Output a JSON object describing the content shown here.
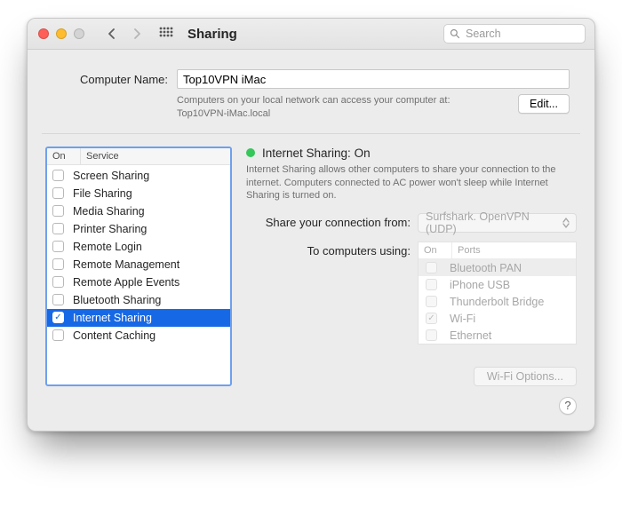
{
  "toolbar": {
    "title": "Sharing",
    "search_placeholder": "Search"
  },
  "computer_name": {
    "label": "Computer Name:",
    "value": "Top10VPN iMac",
    "hint_line1": "Computers on your local network can access your computer at:",
    "hint_line2": "Top10VPN-iMac.local",
    "edit_label": "Edit..."
  },
  "services": {
    "headers": {
      "on": "On",
      "service": "Service"
    },
    "items": [
      {
        "label": "Screen Sharing",
        "checked": false,
        "selected": false
      },
      {
        "label": "File Sharing",
        "checked": false,
        "selected": false
      },
      {
        "label": "Media Sharing",
        "checked": false,
        "selected": false
      },
      {
        "label": "Printer Sharing",
        "checked": false,
        "selected": false
      },
      {
        "label": "Remote Login",
        "checked": false,
        "selected": false
      },
      {
        "label": "Remote Management",
        "checked": false,
        "selected": false
      },
      {
        "label": "Remote Apple Events",
        "checked": false,
        "selected": false
      },
      {
        "label": "Bluetooth Sharing",
        "checked": false,
        "selected": false
      },
      {
        "label": "Internet Sharing",
        "checked": true,
        "selected": true
      },
      {
        "label": "Content Caching",
        "checked": false,
        "selected": false
      }
    ]
  },
  "detail": {
    "status_label": "Internet Sharing: On",
    "status_color": "#34c759",
    "description": "Internet Sharing allows other computers to share your connection to the internet. Computers connected to AC power won't sleep while Internet Sharing is turned on.",
    "share_from_label": "Share your connection from:",
    "share_from_value": "Surfshark. OpenVPN (UDP)",
    "to_using_label": "To computers using:",
    "ports_headers": {
      "on": "On",
      "ports": "Ports"
    },
    "ports": [
      {
        "label": "Bluetooth PAN",
        "checked": false,
        "selected": true
      },
      {
        "label": "iPhone USB",
        "checked": false,
        "selected": false
      },
      {
        "label": "Thunderbolt Bridge",
        "checked": false,
        "selected": false
      },
      {
        "label": "Wi-Fi",
        "checked": true,
        "selected": false
      },
      {
        "label": "Ethernet",
        "checked": false,
        "selected": false
      }
    ],
    "wifi_options_label": "Wi-Fi Options..."
  },
  "help_label": "?"
}
